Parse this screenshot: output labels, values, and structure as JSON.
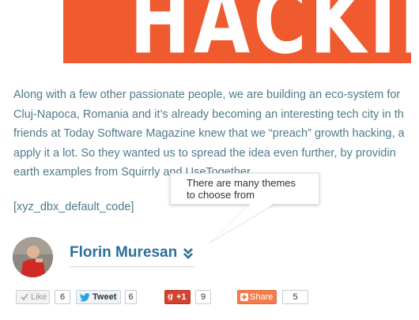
{
  "banner": {
    "text": "HACKING",
    "color": "#ef5a2f"
  },
  "article": {
    "lines": [
      "Along with a few other passionate people, we are building an eco-system for",
      "Cluj-Napoca, Romania and it’s already becoming an interesting tech city in th",
      "friends at Today Software Magazine knew that we “preach” growth hacking, a",
      "apply it a lot. So they wanted us to spread the idea even further, by providin",
      "earth examples from Squirrly and UseTogether."
    ],
    "shortcode": "[xyz_dbx_default_code]",
    "text_color": "#4f7a8a"
  },
  "tooltip": {
    "line1": "There are many themes",
    "line2": "to choose from"
  },
  "author": {
    "name": "Florin Muresan",
    "name_color": "#2c6f9a"
  },
  "social": {
    "like": {
      "label": "Like",
      "count": "6"
    },
    "tweet": {
      "label": "Tweet",
      "count": "6"
    },
    "gplus": {
      "label": "+1",
      "count": "9"
    },
    "share": {
      "label": "Share",
      "count": "5"
    }
  }
}
